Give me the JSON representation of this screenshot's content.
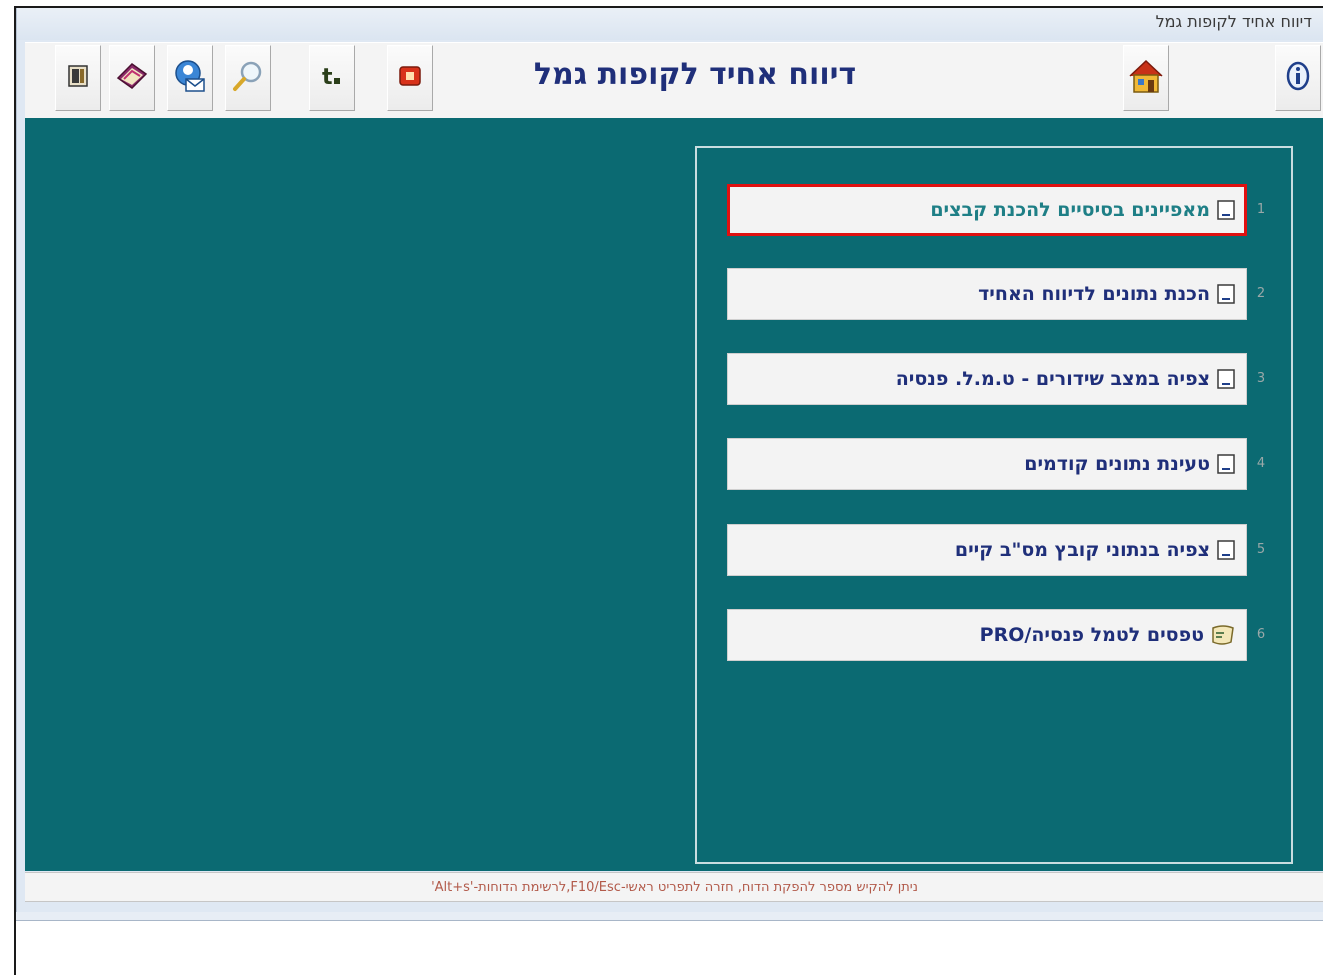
{
  "window": {
    "title": "דיווח אחיד לקופות גמל"
  },
  "header": {
    "title": "דיווח אחיד לקופות גמל"
  },
  "toolbar": {
    "buttons": [
      {
        "icon": "door-exit-icon"
      },
      {
        "icon": "book-icon"
      },
      {
        "icon": "mail-person-icon"
      },
      {
        "icon": "magnifier-icon"
      },
      {
        "icon": "font-t-icon"
      },
      {
        "icon": "video-icon"
      },
      {
        "icon": "house-icon"
      },
      {
        "icon": "info-icon"
      }
    ]
  },
  "menu": {
    "items": [
      {
        "number": "1",
        "label": "מאפיינים בסיסיים להכנת קבצים",
        "selected": true
      },
      {
        "number": "2",
        "label": "הכנת נתונים לדיווח האחיד"
      },
      {
        "number": "3",
        "label": "צפיה במצב שידורים - ט.מ.ל. פנסיה"
      },
      {
        "number": "4",
        "label": "טעינת נתונים קודמים"
      },
      {
        "number": "5",
        "label": "צפיה בנתוני קובץ מס\"ב קיים"
      },
      {
        "number": "6",
        "label": "טפסים לטמל פנסיה/PRO"
      }
    ]
  },
  "status": {
    "text": "ניתן להקיש מספר להפקת הדוח, חזרה לתפריט ראשי-F10/Esc,לרשימת הדוחות-'Alt+s'"
  },
  "colors": {
    "main_bg": "#0b6a72",
    "title_blue": "#1f2f7a",
    "selection_red": "#e01010",
    "status_text": "#b25a4a"
  }
}
